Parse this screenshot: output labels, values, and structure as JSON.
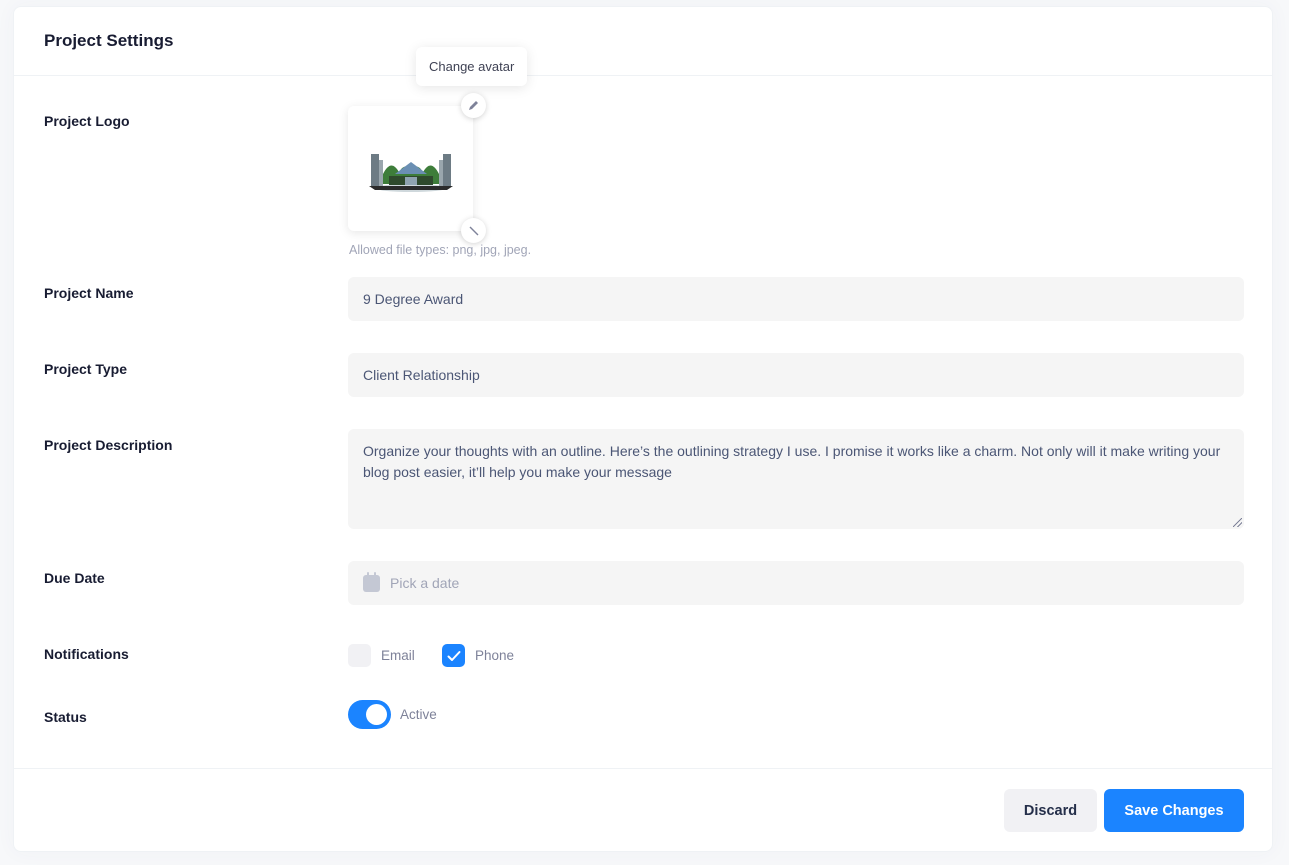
{
  "header": {
    "title": "Project Settings"
  },
  "logo": {
    "label": "Project Logo",
    "tooltip": "Change avatar",
    "hint": "Allowed file types: png, jpg, jpeg.",
    "edit_icon": "pencil-icon",
    "remove_icon": "close-icon"
  },
  "name": {
    "label": "Project Name",
    "value": "9 Degree Award"
  },
  "type": {
    "label": "Project Type",
    "value": "Client Relationship"
  },
  "description": {
    "label": "Project Description",
    "value": "Organize your thoughts with an outline. Here’s the outlining strategy I use. I promise it works like a charm. Not only will it make writing your blog post easier, it’ll help you make your message"
  },
  "due_date": {
    "label": "Due Date",
    "placeholder": "Pick a date",
    "icon": "calendar-icon"
  },
  "notifications": {
    "label": "Notifications",
    "options": [
      {
        "label": "Email",
        "checked": false
      },
      {
        "label": "Phone",
        "checked": true
      }
    ]
  },
  "status": {
    "label": "Status",
    "value_label": "Active",
    "on": true
  },
  "footer": {
    "discard_label": "Discard",
    "save_label": "Save Changes"
  },
  "colors": {
    "primary": "#1b84ff",
    "input_bg": "#f5f5f5"
  }
}
